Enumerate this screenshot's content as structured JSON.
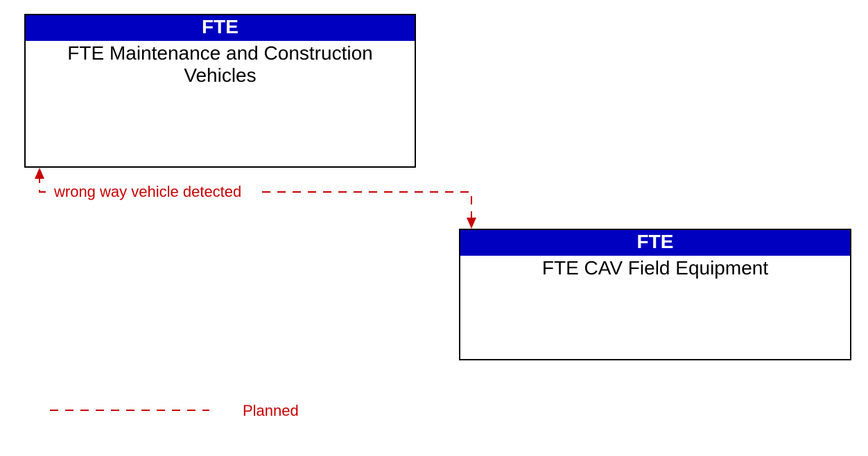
{
  "boxes": {
    "top": {
      "header": "FTE",
      "body": "FTE Maintenance and Construction Vehicles"
    },
    "bottom": {
      "header": "FTE",
      "body": "FTE CAV Field Equipment"
    }
  },
  "flow": {
    "label": "wrong way vehicle detected"
  },
  "legend": {
    "planned": "Planned"
  }
}
